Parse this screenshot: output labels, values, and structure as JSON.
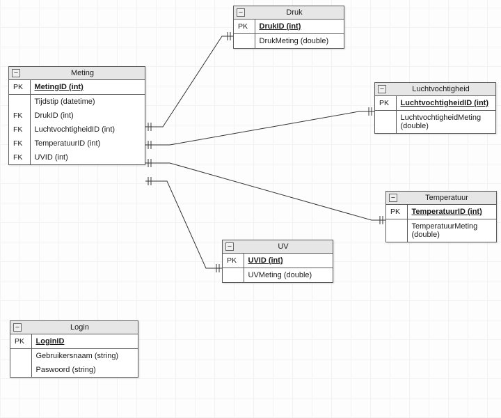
{
  "entities": {
    "meting": {
      "title": "Meting",
      "pk_label": "PK",
      "pk_field": "MetingID (int)",
      "rows": [
        {
          "key": "",
          "field": "Tijdstip (datetime)"
        },
        {
          "key": "FK",
          "field": "DrukID (int)"
        },
        {
          "key": "FK",
          "field": "LuchtvochtigheidID (int)"
        },
        {
          "key": "FK",
          "field": "TemperatuurID (int)"
        },
        {
          "key": "FK",
          "field": "UVID (int)"
        }
      ]
    },
    "druk": {
      "title": "Druk",
      "pk_label": "PK",
      "pk_field": "DrukID (int)",
      "rows": [
        {
          "key": "",
          "field": "DrukMeting (double)"
        }
      ]
    },
    "luchtvochtigheid": {
      "title": "Luchtvochtigheid",
      "pk_label": "PK",
      "pk_field": "LuchtvochtigheidID (int)",
      "rows": [
        {
          "key": "",
          "field": "LuchtvochtigheidMeting (double)"
        }
      ]
    },
    "temperatuur": {
      "title": "Temperatuur",
      "pk_label": "PK",
      "pk_field": "TemperatuurID (int)",
      "rows": [
        {
          "key": "",
          "field": "TemperatuurMeting (double)"
        }
      ]
    },
    "uv": {
      "title": "UV",
      "pk_label": "PK",
      "pk_field": "UVID (int)",
      "rows": [
        {
          "key": "",
          "field": "UVMeting (double)"
        }
      ]
    },
    "login": {
      "title": "Login",
      "pk_label": "PK",
      "pk_field": "LoginID",
      "rows": [
        {
          "key": "",
          "field": "Gebruikersnaam (string)"
        },
        {
          "key": "",
          "field": "Paswoord (string)"
        }
      ]
    }
  },
  "chart_data": {
    "type": "diagram",
    "kind": "entity-relationship",
    "entities": [
      {
        "name": "Meting",
        "pk": "MetingID (int)",
        "columns": [
          "Tijdstip (datetime)",
          "DrukID (int) FK",
          "LuchtvochtigheidID (int) FK",
          "TemperatuurID (int) FK",
          "UVID (int) FK"
        ]
      },
      {
        "name": "Druk",
        "pk": "DrukID (int)",
        "columns": [
          "DrukMeting (double)"
        ]
      },
      {
        "name": "Luchtvochtigheid",
        "pk": "LuchtvochtigheidID (int)",
        "columns": [
          "LuchtvochtigheidMeting (double)"
        ]
      },
      {
        "name": "Temperatuur",
        "pk": "TemperatuurID (int)",
        "columns": [
          "TemperatuurMeting (double)"
        ]
      },
      {
        "name": "UV",
        "pk": "UVID (int)",
        "columns": [
          "UVMeting (double)"
        ]
      },
      {
        "name": "Login",
        "pk": "LoginID",
        "columns": [
          "Gebruikersnaam (string)",
          "Paswoord (string)"
        ]
      }
    ],
    "relationships": [
      {
        "from": "Meting.DrukID",
        "to": "Druk.DrukID"
      },
      {
        "from": "Meting.LuchtvochtigheidID",
        "to": "Luchtvochtigheid.LuchtvochtigheidID"
      },
      {
        "from": "Meting.TemperatuurID",
        "to": "Temperatuur.TemperatuurID"
      },
      {
        "from": "Meting.UVID",
        "to": "UV.UVID"
      }
    ]
  }
}
